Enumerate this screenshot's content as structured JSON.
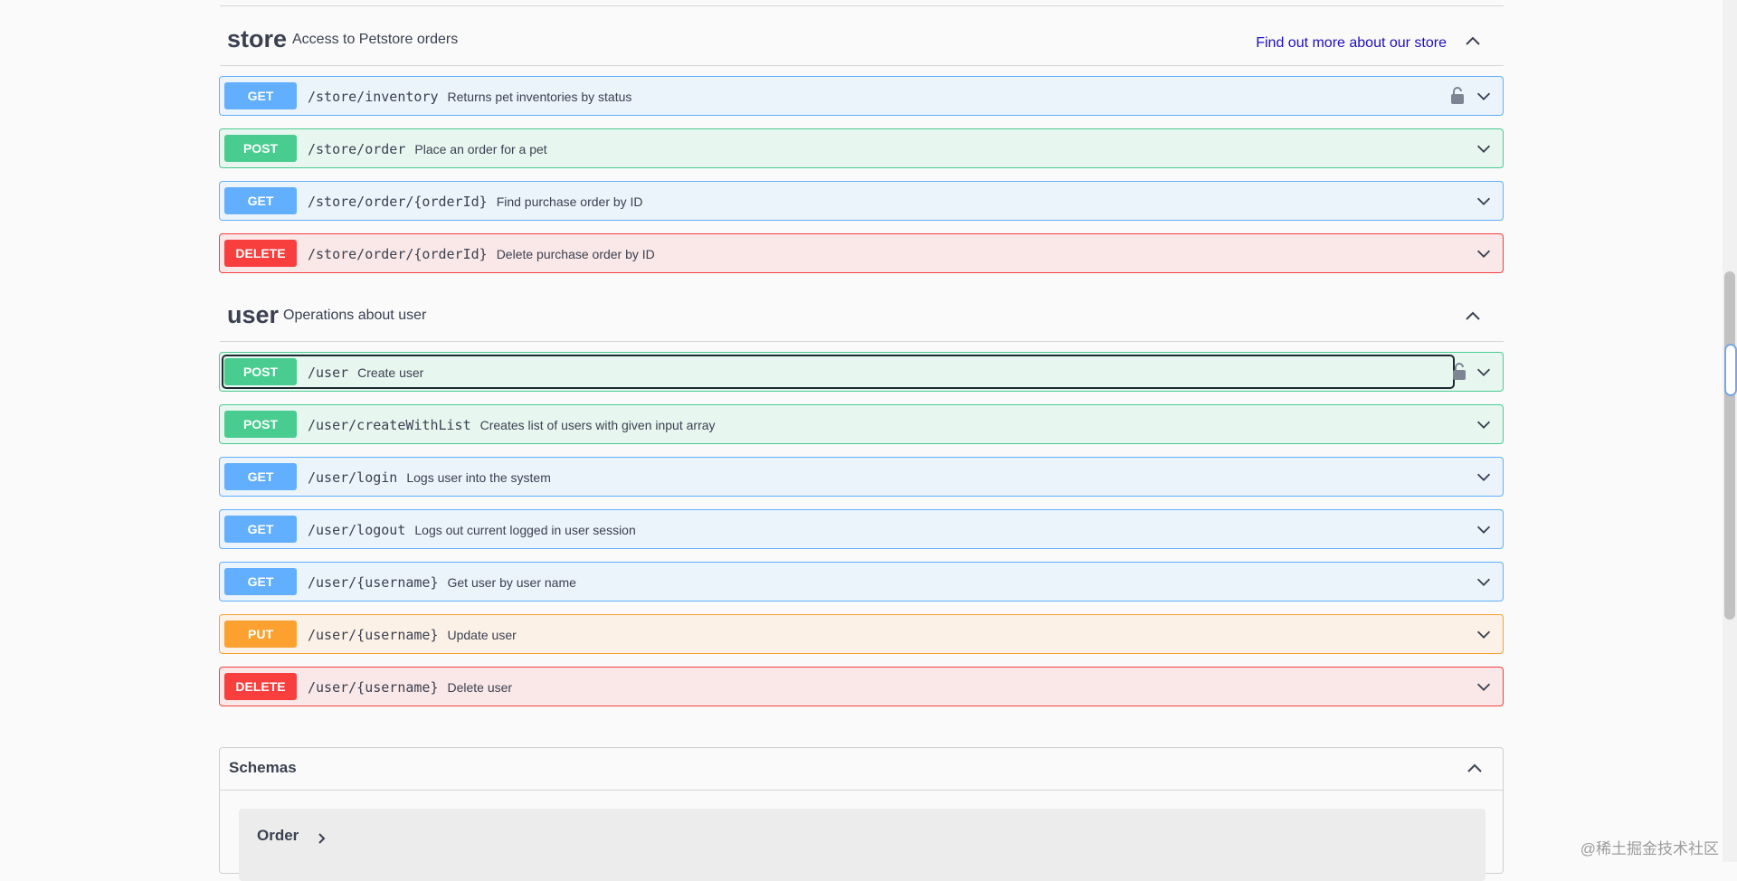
{
  "store": {
    "title": "store",
    "description": "Access to Petstore orders",
    "link": "Find out more about our store",
    "operations": [
      {
        "method": "GET",
        "path": "/store/inventory",
        "summary": "Returns pet inventories by status"
      },
      {
        "method": "POST",
        "path": "/store/order",
        "summary": "Place an order for a pet"
      },
      {
        "method": "GET",
        "path": "/store/order/{orderId}",
        "summary": "Find purchase order by ID"
      },
      {
        "method": "DELETE",
        "path": "/store/order/{orderId}",
        "summary": "Delete purchase order by ID"
      }
    ]
  },
  "user": {
    "title": "user",
    "description": "Operations about user",
    "operations": [
      {
        "method": "POST",
        "path": "/user",
        "summary": "Create user"
      },
      {
        "method": "POST",
        "path": "/user/createWithList",
        "summary": "Creates list of users with given input array"
      },
      {
        "method": "GET",
        "path": "/user/login",
        "summary": "Logs user into the system"
      },
      {
        "method": "GET",
        "path": "/user/logout",
        "summary": "Logs out current logged in user session"
      },
      {
        "method": "GET",
        "path": "/user/{username}",
        "summary": "Get user by user name"
      },
      {
        "method": "PUT",
        "path": "/user/{username}",
        "summary": "Update user"
      },
      {
        "method": "DELETE",
        "path": "/user/{username}",
        "summary": "Delete user"
      }
    ]
  },
  "schemas": {
    "title": "Schemas",
    "first_model": "Order"
  },
  "watermark": "@稀土掘金技术社区",
  "icons": {
    "collapse": "chevron-up-icon",
    "expand": "chevron-down-icon",
    "lock": "lock-icon",
    "model": "chevron-right-icon"
  },
  "colors": {
    "get": "#61affe",
    "post": "#49cc90",
    "delete": "#f93e3e",
    "put": "#fca130",
    "link": "#1f0ec4"
  }
}
